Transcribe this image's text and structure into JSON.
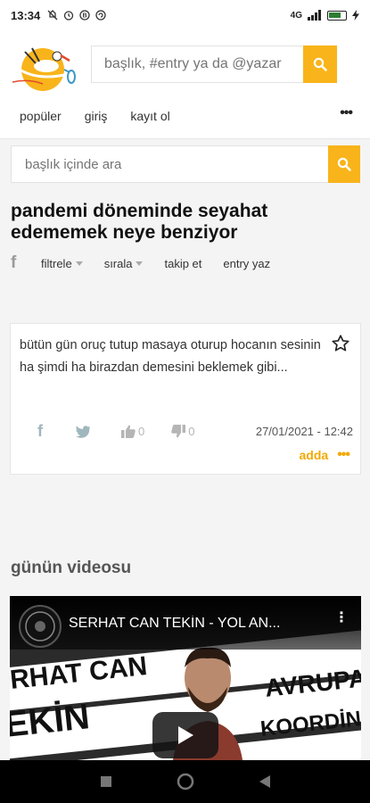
{
  "status_bar": {
    "time": "13:34",
    "signal": "4G",
    "battery": ""
  },
  "header": {
    "search_placeholder": "başlık, #entry ya da @yazar",
    "nav": [
      "popüler",
      "giriş",
      "kayıt ol"
    ],
    "more": "•••"
  },
  "topic_search": {
    "placeholder": "başlık içinde ara"
  },
  "topic": {
    "title": "pandemi döneminde seyahat edememek neye benziyor",
    "actions": {
      "filter": "filtrele",
      "sort": "sırala",
      "follow": "takip et",
      "write": "entry yaz"
    }
  },
  "entry": {
    "text": "bütün gün oruç tutup masaya oturup hocanın sesinin ha şimdi ha birazdan demesini beklemek gibi...",
    "upvotes": "0",
    "downvotes": "0",
    "date": "27/01/2021 - 12:42",
    "author": "adda",
    "more": "•••"
  },
  "video_section": {
    "title": "günün videosu",
    "video_title": "SERHAT CAN TEKİN - YOL AN...",
    "overlay_words": [
      "RHAT CAN",
      "EKİN",
      "AVRUPA",
      "KOORDİN"
    ]
  },
  "colors": {
    "accent": "#f8b41a",
    "author": "#f2a900"
  }
}
